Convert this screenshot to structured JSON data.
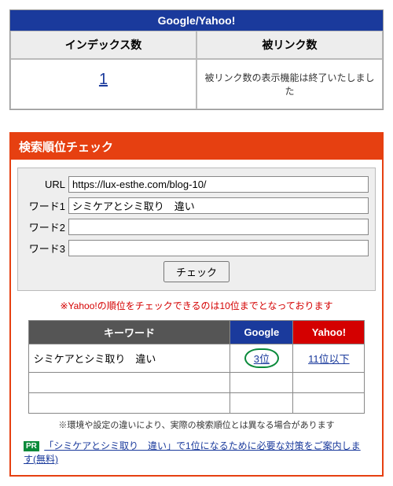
{
  "top": {
    "header": "Google/Yahoo!",
    "cols": {
      "index_label": "インデックス数",
      "back_label": "被リンク数"
    },
    "index_value": "1",
    "back_message": "被リンク数の表示機能は終了いたしました"
  },
  "rank": {
    "title": "検索順位チェック",
    "labels": {
      "url": "URL",
      "w1": "ワード1",
      "w2": "ワード2",
      "w3": "ワード3"
    },
    "fields": {
      "url": "https://lux-esthe.com/blog-10/",
      "w1": "シミケアとシミ取り　違い",
      "w2": "",
      "w3": ""
    },
    "button": "チェック",
    "note_red": "※Yahoo!の順位をチェックできるのは10位までとなっております",
    "table": {
      "headers": {
        "kw": "キーワード",
        "google": "Google",
        "yahoo": "Yahoo!"
      },
      "rows": [
        {
          "kw": "シミケアとシミ取り　違い",
          "google": "3位",
          "yahoo": "11位以下"
        },
        {
          "kw": "",
          "google": "",
          "yahoo": ""
        },
        {
          "kw": "",
          "google": "",
          "yahoo": ""
        }
      ]
    },
    "note_small": "※環境や設定の違いにより、実際の検索順位とは異なる場合があります",
    "pr": {
      "badge": "PR",
      "text": "「シミケアとシミ取り　違い」で1位になるために必要な対策をご案内します(無料)"
    }
  }
}
